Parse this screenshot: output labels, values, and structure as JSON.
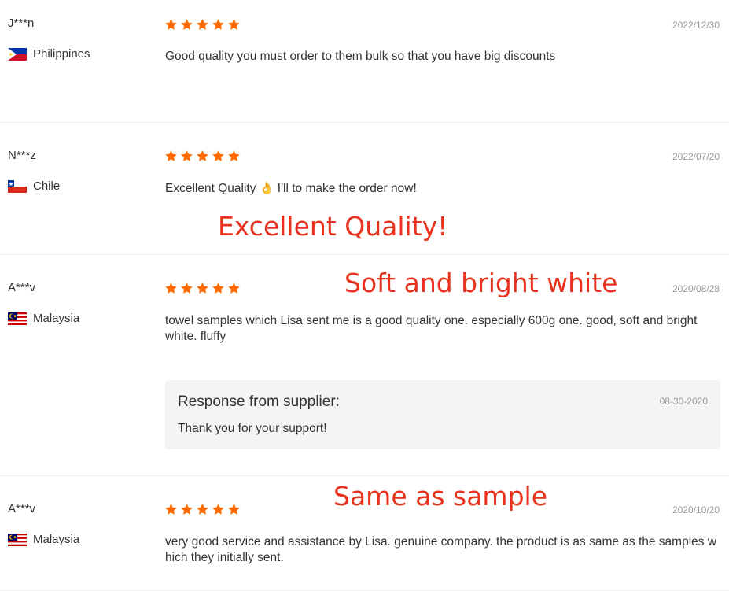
{
  "reviews": [
    {
      "user": "J***n",
      "country": "Philippines",
      "flag": "philippines-flag-icon",
      "rating": 5,
      "date": "2022/12/30",
      "comment": "Good quality you must order to them bulk so that you have big discounts"
    },
    {
      "user": "N***z",
      "country": "Chile",
      "flag": "chile-flag-icon",
      "rating": 5,
      "date": "2022/07/20",
      "comment_prefix": "Excellent Quality",
      "comment_emoji": "👌",
      "comment_suffix": "I'll to make the order now!"
    },
    {
      "user": "A***v",
      "country": "Malaysia",
      "flag": "malaysia-flag-icon",
      "rating": 5,
      "date": "2020/08/28",
      "comment": "towel samples which Lisa sent me is a good quality one. especially 600g one. good, soft and bright white. fluffy",
      "response": {
        "title": "Response from supplier:",
        "date": "08-30-2020",
        "text": "Thank you for your support!"
      }
    },
    {
      "user": "A***v",
      "country": "Malaysia",
      "flag": "malaysia-flag-icon",
      "rating": 5,
      "date": "2020/10/20",
      "comment": "very good service and assistance by Lisa. genuine company. the product is as same as the samples which they initially sent."
    }
  ],
  "overlays": {
    "excellent": "Excellent Quality!",
    "soft": "Soft and bright white",
    "same": "Same as sample"
  },
  "colors": {
    "star": "#ff6a00",
    "overlay": "#e8321e",
    "date": "#999999"
  }
}
